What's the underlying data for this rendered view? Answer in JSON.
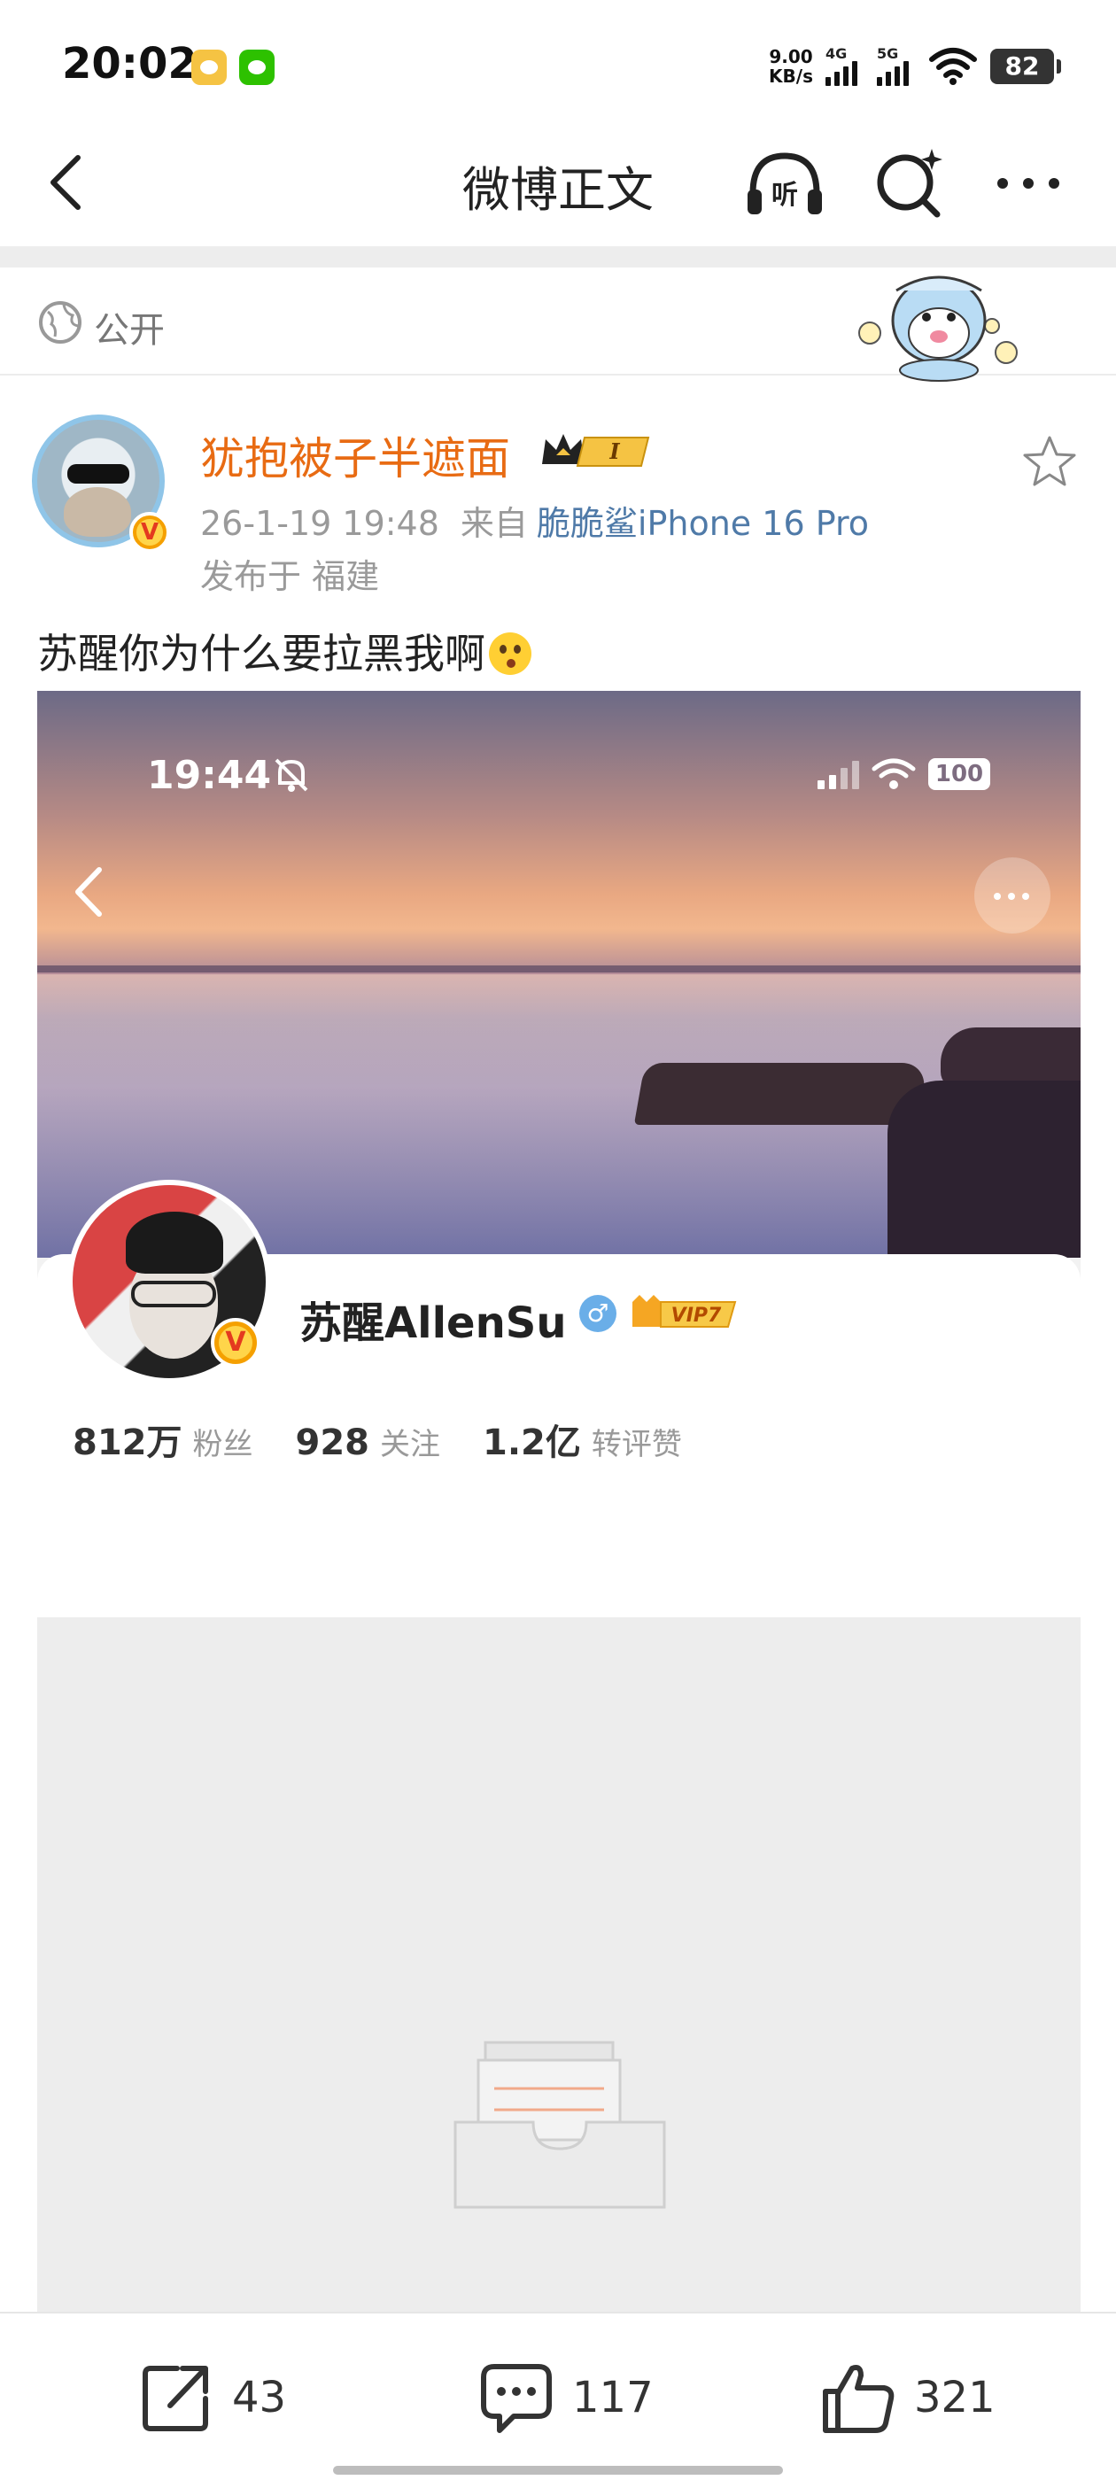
{
  "status_bar": {
    "time": "20:02",
    "net_speed_value": "9.00",
    "net_speed_unit": "KB/s",
    "net1": "4G",
    "net2": "5G",
    "battery": "82",
    "icons": [
      "weibo-icon",
      "wechat-icon",
      "signal-icon",
      "wifi-icon",
      "battery-icon"
    ]
  },
  "nav": {
    "title": "微博正文",
    "listen_label": "听",
    "icons": [
      "back-arrow-icon",
      "listen-headphones-icon",
      "search-sparkle-icon",
      "more-dots-icon"
    ]
  },
  "visibility": {
    "label": "公开",
    "icon": "globe-icon"
  },
  "post": {
    "username": "犹抱被子半遮面",
    "level_badge": "I",
    "timestamp": "26-1-19 19:48",
    "from_label": "来自",
    "device": "脆脆鲨iPhone 16 Pro",
    "location": "发布于 福建",
    "text": "苏醒你为什么要拉黑我啊",
    "emoji": "surprised-face-emoji"
  },
  "embedded_screenshot": {
    "time": "19:44",
    "battery": "100",
    "profile": {
      "name": "苏醒AllenSu",
      "gender": "♂",
      "vip": "VIP7",
      "stats": [
        {
          "value": "812万",
          "label": "粉丝"
        },
        {
          "value": "928",
          "label": "关注"
        },
        {
          "value": "1.2亿",
          "label": "转评赞"
        }
      ]
    }
  },
  "actions": {
    "share_count": "43",
    "comment_count": "117",
    "like_count": "321"
  },
  "colors": {
    "username": "#e86b13",
    "device_link": "#4f7aa8",
    "meta_gray": "#9a9a9a",
    "placeholder_bg": "#ededed"
  }
}
